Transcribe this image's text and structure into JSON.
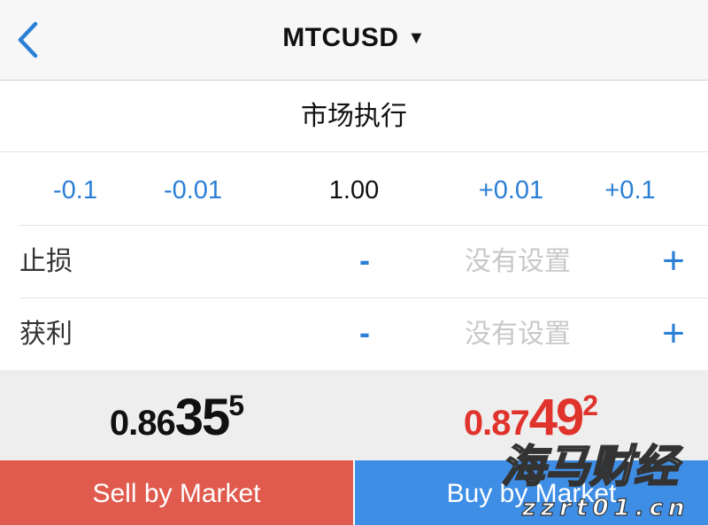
{
  "header": {
    "symbol": "MTCUSD",
    "caret": "▼"
  },
  "order_mode": "市场执行",
  "volume": {
    "steps": [
      "-0.1",
      "-0.01",
      "+0.01",
      "+0.1"
    ],
    "value": "1.00"
  },
  "stop_loss": {
    "label": "止损",
    "minus": "-",
    "value": "没有设置",
    "plus": "+"
  },
  "take_profit": {
    "label": "获利",
    "minus": "-",
    "value": "没有设置",
    "plus": "+"
  },
  "bid": {
    "prefix": "0.86",
    "big": "35",
    "sup": "5"
  },
  "ask": {
    "prefix": "0.87",
    "big": "49",
    "sup": "2"
  },
  "buttons": {
    "sell": "Sell by Market",
    "buy": "Buy by Market"
  },
  "watermark": {
    "chinese": "海马财经",
    "site": "zzrt01.cn"
  },
  "colors": {
    "accent": "#2a7fd6",
    "sell": "#e05a4e",
    "buy": "#3f8ee6",
    "ask_price": "#e0332c",
    "placeholder": "#c8c8c8"
  }
}
